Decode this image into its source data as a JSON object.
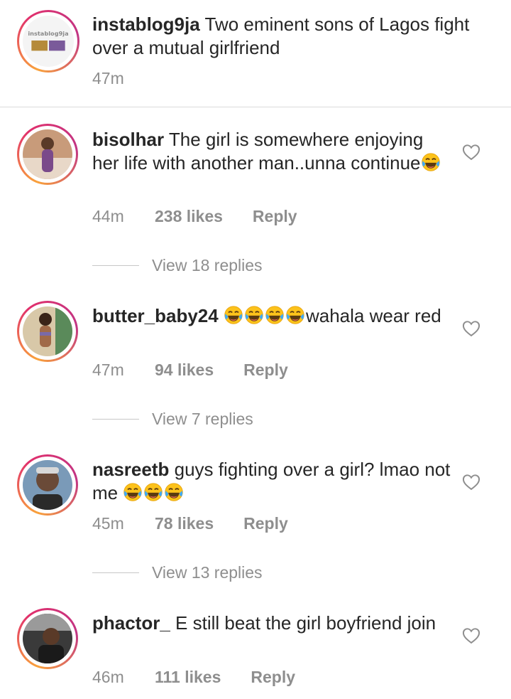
{
  "post": {
    "username": "instablog9ja",
    "caption": "Two eminent sons of Lagos fight over a mutual girlfriend",
    "time": "47m",
    "avatar_logo": "instablog9ja"
  },
  "comments": [
    {
      "username": "bisolhar",
      "text": "The girl is somewhere enjoying her life with another man..unna continue",
      "emoji_count": 1,
      "time": "44m",
      "likes": "238 likes",
      "reply": "Reply",
      "view_replies": "View 18 replies"
    },
    {
      "username": "butter_baby24",
      "text_after_emoji": "wahala wear red",
      "emoji_count": 4,
      "time": "47m",
      "likes": "94 likes",
      "reply": "Reply",
      "view_replies": "View 7 replies"
    },
    {
      "username": "nasreetb",
      "text": "guys fighting over a girl? lmao not me",
      "emoji_count": 3,
      "time": "45m",
      "likes": "78 likes",
      "reply": "Reply",
      "view_replies": "View 13 replies"
    },
    {
      "username": "phactor_",
      "text": "E still beat the girl boyfriend join",
      "time": "46m",
      "likes": "111 likes",
      "reply": "Reply"
    }
  ],
  "icons": {
    "heart": "heart-outline-icon",
    "emoji": "face-with-tears-of-joy-emoji"
  },
  "colors": {
    "text": "#262626",
    "secondary": "#8e8e8e",
    "ring_start": "#f9a23b",
    "ring_end": "#c13584"
  }
}
